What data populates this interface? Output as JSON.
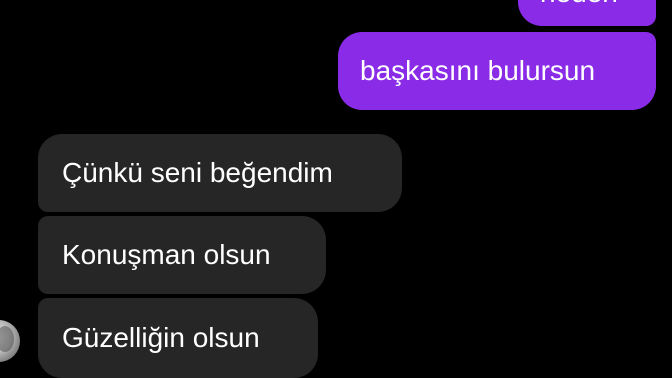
{
  "conversation": {
    "sent_messages": [
      {
        "text": "neden"
      },
      {
        "text": "başkasını bulursun"
      }
    ],
    "received_messages": [
      {
        "text": "Çünkü seni beğendim"
      },
      {
        "text": "Konuşman olsun"
      },
      {
        "text": "Güzelliğin olsun"
      }
    ],
    "avatar": {
      "icon": "profile-avatar"
    }
  },
  "colors": {
    "background": "#000000",
    "sent_bubble": "#8a2be8",
    "received_bubble": "#262626",
    "text": "#ffffff"
  }
}
